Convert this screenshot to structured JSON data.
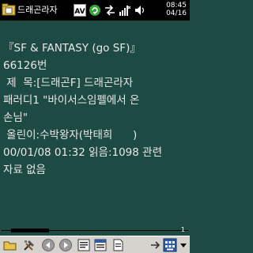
{
  "title_bar": {
    "app_title": "드래곤라자",
    "time": "08:45",
    "date": "04/16"
  },
  "article": {
    "lines": [
      "『SF & FANTASY (go SF)』",
      "66126번",
      " 제  목:[드래곤F] 드래곤라자",
      "패러디1 \"바이서스임펠에서 온",
      "손님\"",
      " 올린이:수박왕자(박태희      )",
      "00/01/08 01:32 읽음:1098 관련",
      "자료 없음"
    ]
  },
  "scroll": {
    "value": "1"
  },
  "icons": {
    "app": "folder-doc-icon",
    "status": [
      "av-icon",
      "sync-icon",
      "connectivity-icon",
      "signal-icon",
      "volume-icon"
    ],
    "toolbar": [
      "folder-icon",
      "tools-icon",
      "back-icon",
      "forward-icon",
      "bookmark-icon",
      "find-icon",
      "document-icon",
      "keyboard-icon"
    ]
  }
}
